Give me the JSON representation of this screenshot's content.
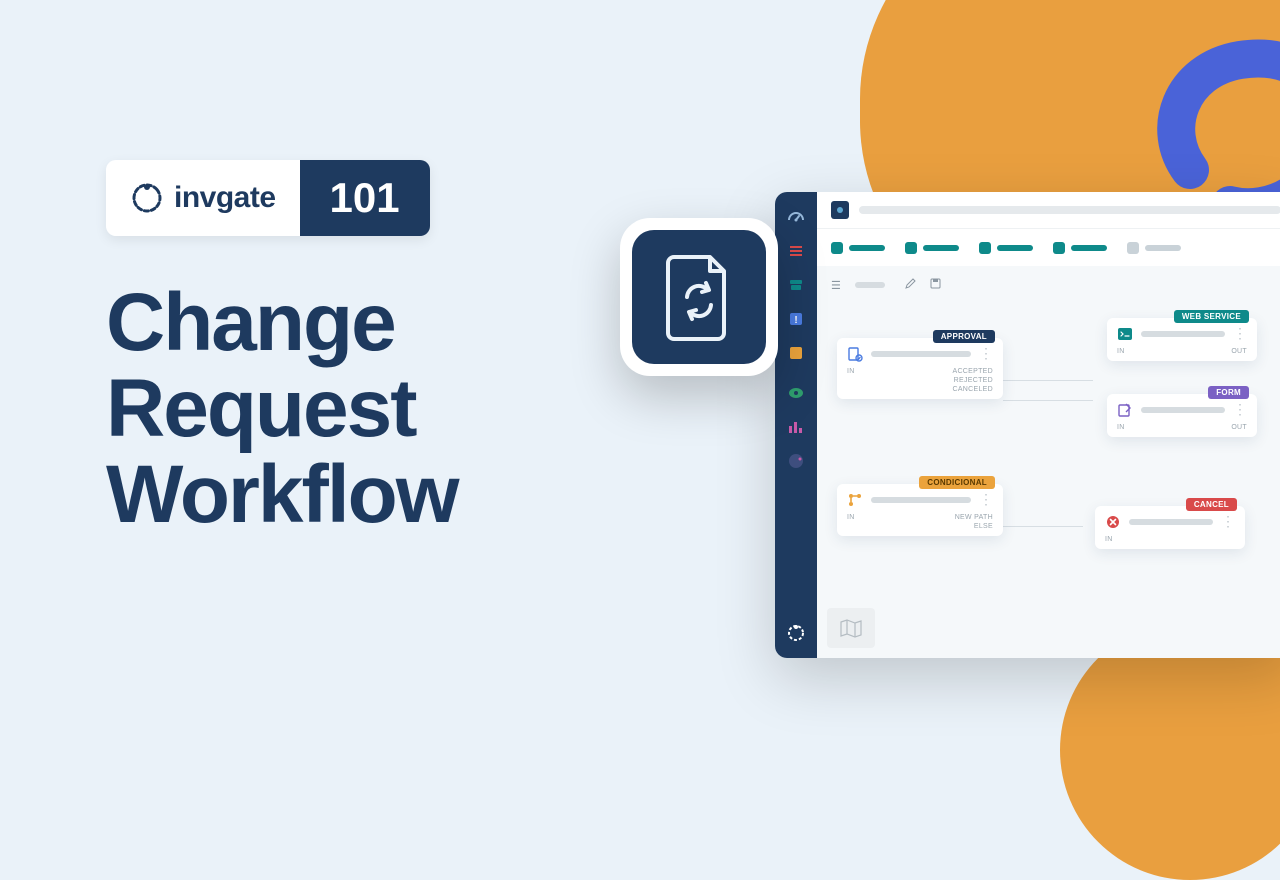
{
  "brand": {
    "name": "invgate",
    "badge_number": "101"
  },
  "title": {
    "line1": "Change",
    "line2": "Request",
    "line3": "Workflow"
  },
  "workflow": {
    "nodes": {
      "approval": {
        "tag": "APPROVAL",
        "in": "IN",
        "outs": [
          "ACCEPTED",
          "REJECTED",
          "CANCELED"
        ]
      },
      "webservice": {
        "tag": "WEB SERVICE",
        "in": "IN",
        "out": "OUT"
      },
      "form": {
        "tag": "FORM",
        "in": "IN",
        "out": "OUT"
      },
      "conditional": {
        "tag": "CONDICIONAL",
        "in": "IN",
        "outs": [
          "NEW PATH",
          "ELSE"
        ]
      },
      "cancel": {
        "tag": "CANCEL",
        "in": "IN"
      }
    }
  },
  "colors": {
    "navy": "#1E3A5F",
    "teal": "#0E8A8A",
    "purple": "#7B61C4",
    "amber": "#EBA33C",
    "red": "#D94A4A",
    "orange_blob": "#E99F3F",
    "bg": "#EAF2F9"
  }
}
